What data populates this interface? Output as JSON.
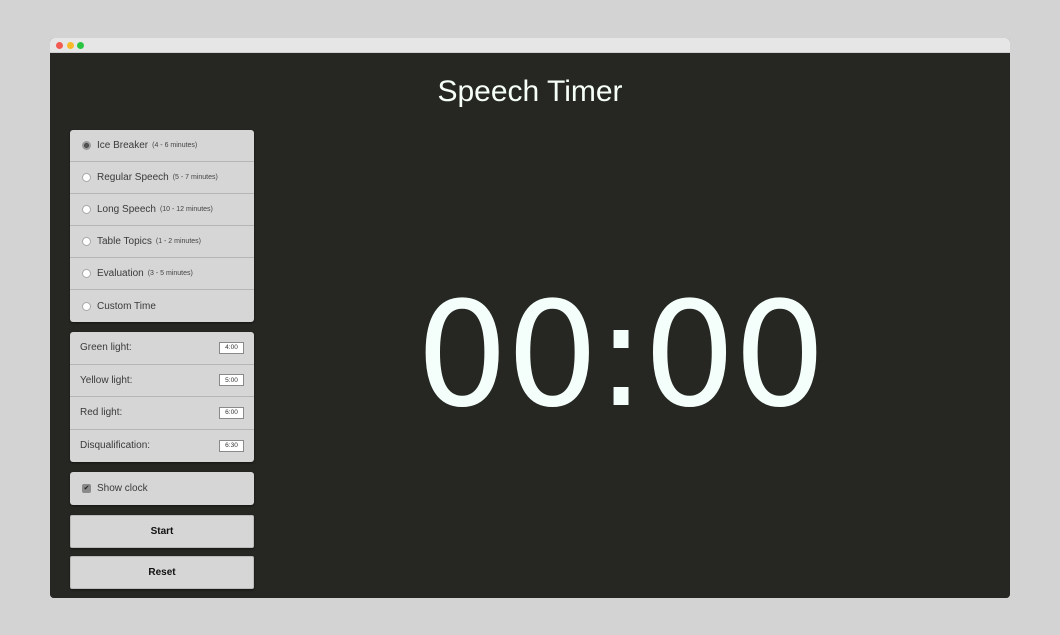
{
  "window": {
    "controls": [
      "close",
      "minimize",
      "maximize"
    ]
  },
  "app": {
    "title": "Speech Timer"
  },
  "speech_types": [
    {
      "label": "Ice Breaker",
      "range": "(4 - 6 minutes)",
      "selected": true
    },
    {
      "label": "Regular Speech",
      "range": "(5 - 7 minutes)",
      "selected": false
    },
    {
      "label": "Long Speech",
      "range": "(10 - 12 minutes)",
      "selected": false
    },
    {
      "label": "Table Topics",
      "range": "(1 - 2 minutes)",
      "selected": false
    },
    {
      "label": "Evaluation",
      "range": "(3 - 5 minutes)",
      "selected": false
    },
    {
      "label": "Custom Time",
      "range": "",
      "selected": false
    }
  ],
  "lights": [
    {
      "label": "Green light:",
      "value": "4:00"
    },
    {
      "label": "Yellow light:",
      "value": "5:00"
    },
    {
      "label": "Red light:",
      "value": "6:00"
    },
    {
      "label": "Disqualification:",
      "value": "6:30"
    }
  ],
  "show_clock": {
    "label": "Show clock",
    "checked": true,
    "check_glyph": "✔"
  },
  "buttons": {
    "start": "Start",
    "reset": "Reset"
  },
  "timer": {
    "display": "00:00"
  }
}
